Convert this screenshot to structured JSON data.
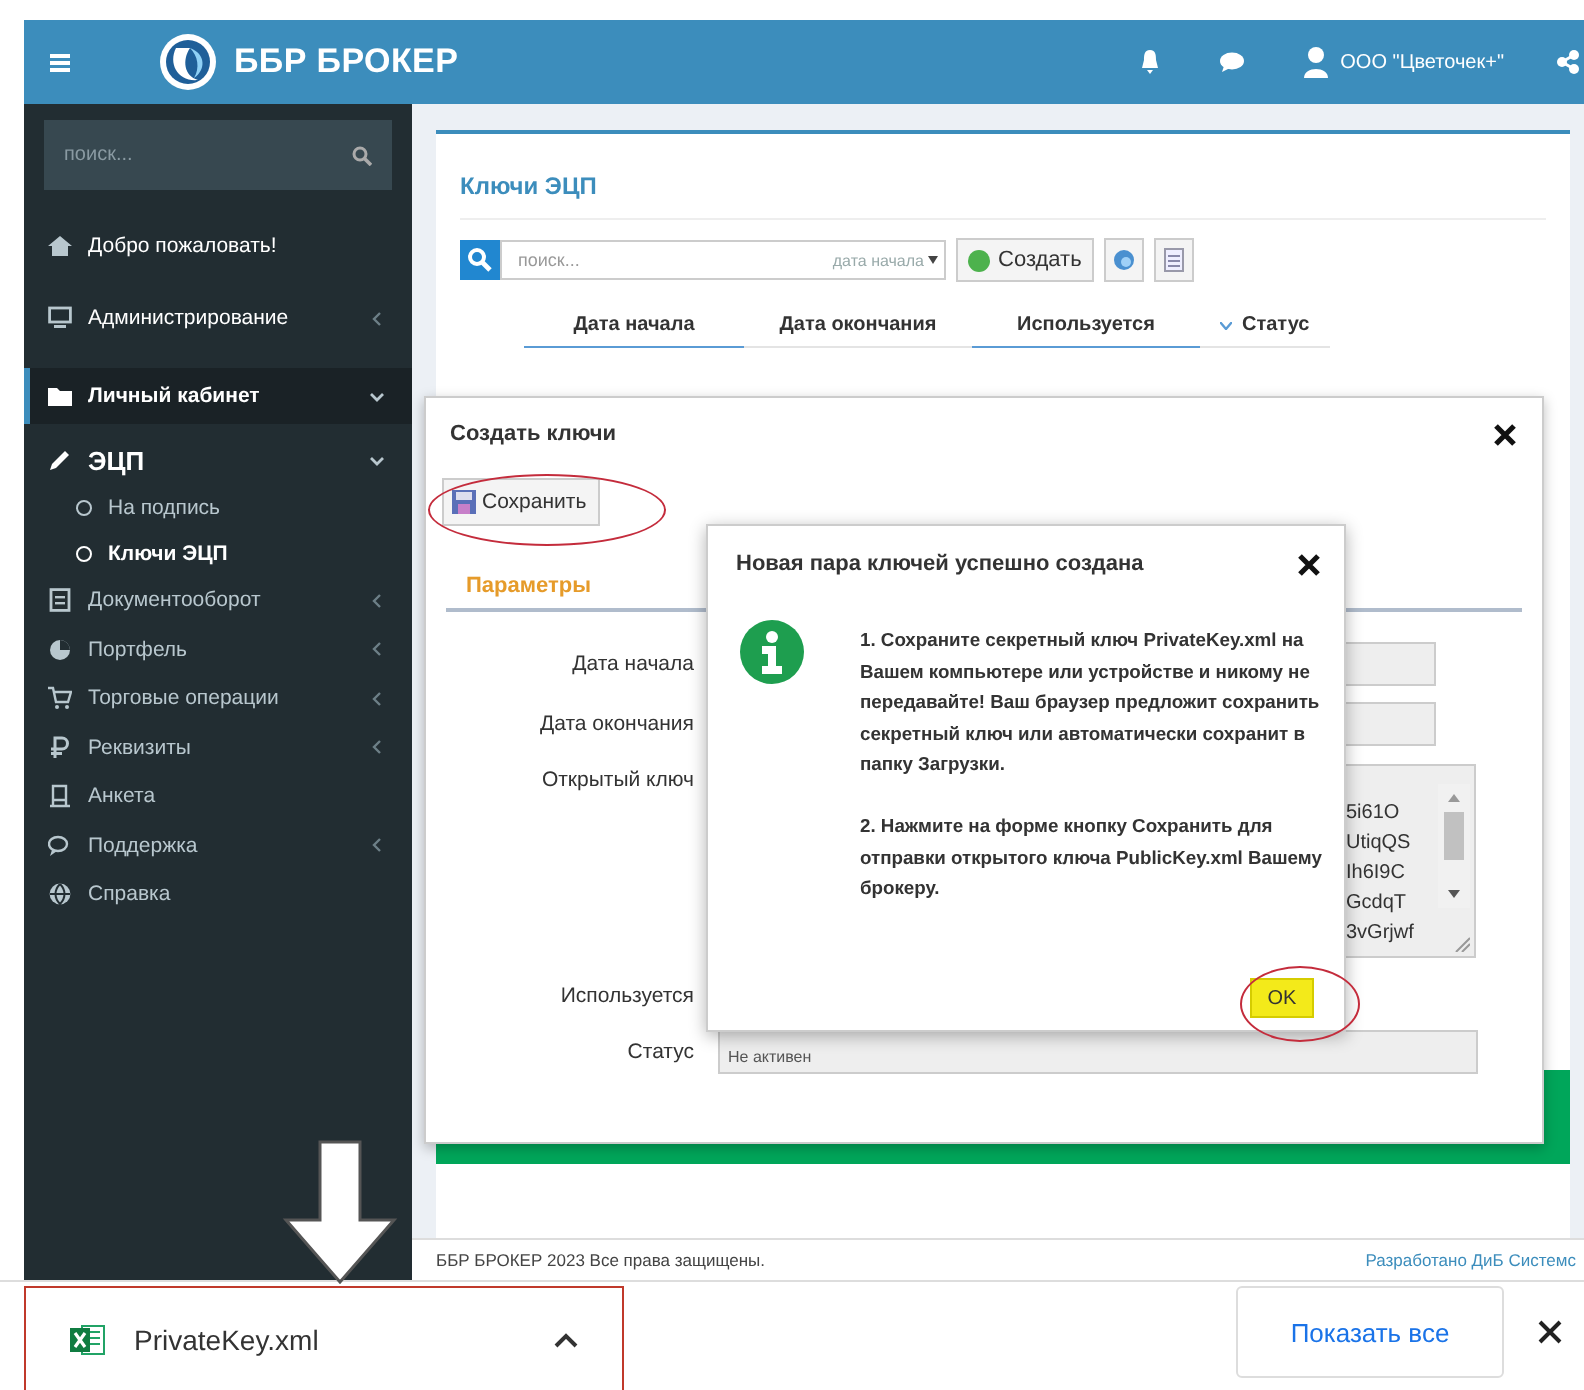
{
  "topbar": {
    "brand": "ББР БРОКЕР",
    "user": "ООО \"Цветочек+\""
  },
  "sidebar": {
    "search_placeholder": "поиск...",
    "items": [
      {
        "label": "Добро пожаловать!",
        "selected": false
      },
      {
        "label": "Администрирование",
        "selected": false,
        "expanded": false
      },
      {
        "label": "Личный кабинет",
        "selected": true,
        "expanded": true,
        "children": [
          {
            "label": "ЭЦП",
            "selected": false,
            "expanded": true,
            "children": [
              {
                "label": "На подпись",
                "selected": false
              },
              {
                "label": "Ключи ЭЦП",
                "selected": true
              }
            ]
          }
        ]
      },
      {
        "label": "Документооборот",
        "selected": false,
        "expanded": false
      },
      {
        "label": "Портфель",
        "selected": false,
        "expanded": false
      },
      {
        "label": "Торговые операции",
        "selected": false,
        "expanded": false
      },
      {
        "label": "Реквизиты",
        "selected": false,
        "expanded": false
      },
      {
        "label": "Анкета",
        "selected": false
      },
      {
        "label": "Поддержка",
        "selected": false,
        "expanded": false
      },
      {
        "label": "Справка",
        "selected": false
      }
    ]
  },
  "page": {
    "title": "Ключи ЭЦП",
    "search_placeholder": "поиск...",
    "sort_field": "дата начала",
    "create_button": "Создать",
    "columns": [
      {
        "label": "Дата начала",
        "highlighted": true,
        "sorted": false
      },
      {
        "label": "Дата окончания",
        "highlighted": false,
        "sorted": false
      },
      {
        "label": "Используется",
        "highlighted": true,
        "sorted": false
      },
      {
        "label": "Статус",
        "highlighted": false,
        "sorted": true
      }
    ]
  },
  "modal": {
    "title": "Создать ключи",
    "save_button": "Сохранить",
    "tabs": [
      {
        "label": "Параметры",
        "selected": true
      }
    ],
    "fields": [
      {
        "label": "Дата начала",
        "kind": "input"
      },
      {
        "label": "Дата окончания",
        "kind": "input"
      },
      {
        "label": "Открытый ключ",
        "kind": "textarea",
        "lines": [
          "5i61O",
          "UtiqQS",
          "Ih6I9C",
          "GcdqT",
          "3vGrjwf"
        ]
      },
      {
        "label": "Используется",
        "kind": "hidden"
      },
      {
        "label": "Статус",
        "kind": "input",
        "value": "Не активен"
      }
    ]
  },
  "dialog": {
    "title": "Новая пара ключей успешно создана",
    "paragraphs": [
      "1. Сохраните секретный ключ PrivateKey.xml на Вашем компьютере или устройстве и никому не передавайте! Ваш браузер предложит сохранить секретный ключ или автоматически сохранит в папку Загрузки.",
      "2. Нажмите на форме кнопку Сохранить для отправки открытого ключа PublicKey.xml Вашему брокеру."
    ],
    "ok_button": "OK"
  },
  "footer": {
    "copyright": "ББР БРОКЕР 2023 Все права защищены.",
    "credit": "Разработано ДиБ Системс"
  },
  "downloads": {
    "file": "PrivateKey.xml",
    "show_all": "Показать все"
  }
}
